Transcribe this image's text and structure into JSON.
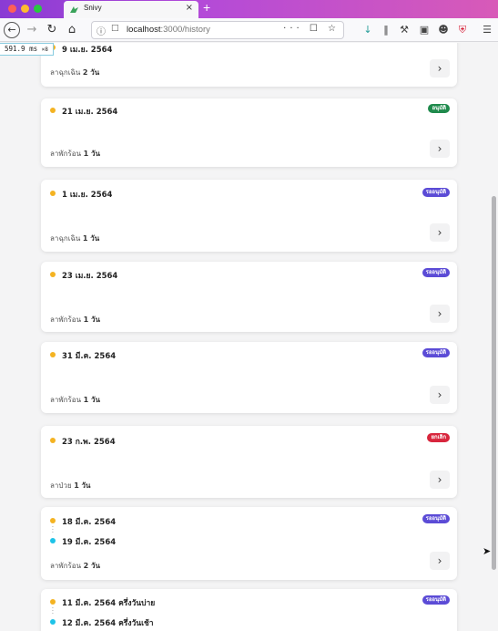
{
  "browser": {
    "tab_title": "Snivy",
    "tab_close": "×",
    "new_tab": "+",
    "url_host": "localhost",
    "url_rest": ":3000/history",
    "url_actions": "··· ☐ ☆"
  },
  "perf": {
    "time": "591.9",
    "unit": "ms",
    "mult": "×8"
  },
  "records": [
    {
      "start": "9 เม.ย. 2564",
      "end": "",
      "status": "",
      "status_color": "",
      "leave_type": "ลาฉุกเฉิน",
      "days": "2 วัน"
    },
    {
      "start": "21 เม.ย. 2564",
      "end": "",
      "status": "อนุมัติ",
      "status_color": "#1f8a4c",
      "leave_type": "ลาพักร้อน",
      "days": "1 วัน"
    },
    {
      "start": "1 เม.ย. 2564",
      "end": "",
      "status": "รออนุมัติ",
      "status_color": "#5b4bd6",
      "leave_type": "ลาฉุกเฉิน",
      "days": "1 วัน"
    },
    {
      "start": "23 เม.ย. 2564",
      "end": "",
      "status": "รออนุมัติ",
      "status_color": "#5b4bd6",
      "leave_type": "ลาพักร้อน",
      "days": "1 วัน"
    },
    {
      "start": "31 มี.ค. 2564",
      "end": "",
      "status": "รออนุมัติ",
      "status_color": "#5b4bd6",
      "leave_type": "ลาพักร้อน",
      "days": "1 วัน"
    },
    {
      "start": "23 ก.พ. 2564",
      "end": "",
      "status": "ยกเลิก",
      "status_color": "#d8263d",
      "leave_type": "ลาป่วย",
      "days": "1 วัน"
    },
    {
      "start": "18 มี.ค. 2564",
      "end": "19 มี.ค. 2564",
      "status": "รออนุมัติ",
      "status_color": "#5b4bd6",
      "leave_type": "ลาพักร้อน",
      "days": "2 วัน"
    },
    {
      "start": "11 มี.ค. 2564 ครึ่งวันบ่าย",
      "end": "12 มี.ค. 2564 ครึ่งวันเช้า",
      "status": "รออนุมัติ",
      "status_color": "#5b4bd6",
      "leave_type": "",
      "days": ""
    }
  ],
  "icons": {
    "chevron": "chevron-right-icon"
  }
}
